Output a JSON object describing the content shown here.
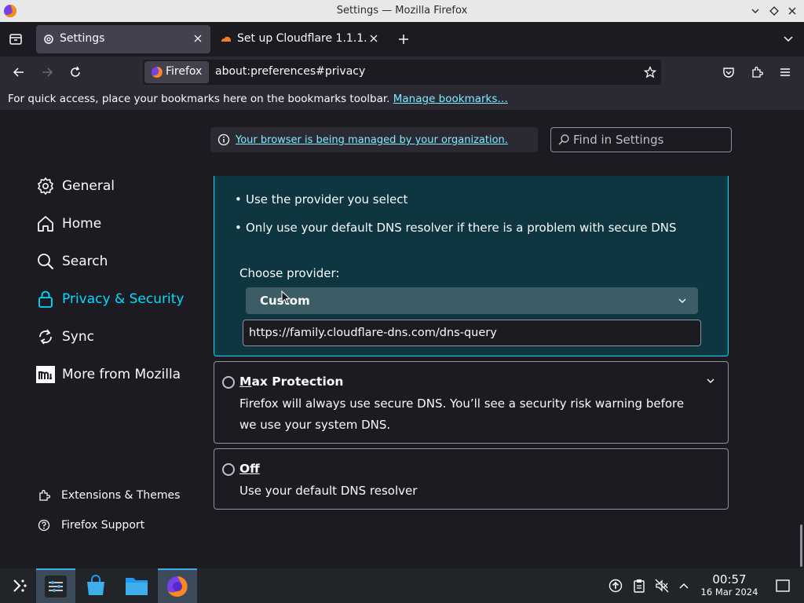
{
  "window": {
    "title": "Settings — Mozilla Firefox",
    "controls": [
      "minimize",
      "maximize",
      "close"
    ]
  },
  "tabs": [
    {
      "label": "Settings",
      "icon": "gear-icon",
      "active": true
    },
    {
      "label": "Set up Cloudflare 1.1.1.1",
      "icon": "cloudflare-icon",
      "active": false
    }
  ],
  "navbar": {
    "identity_label": "Firefox",
    "url": "about:preferences#privacy"
  },
  "bookmarks_bar": {
    "message": "For quick access, place your bookmarks here on the bookmarks toolbar.",
    "link": "Manage bookmarks…"
  },
  "settings": {
    "managed_notice": "Your browser is being managed by your organization.",
    "search_placeholder": "Find in Settings",
    "nav": [
      {
        "label": "General",
        "icon": "gear-icon"
      },
      {
        "label": "Home",
        "icon": "home-icon"
      },
      {
        "label": "Search",
        "icon": "search-icon"
      },
      {
        "label": "Privacy & Security",
        "icon": "lock-icon",
        "selected": true
      },
      {
        "label": "Sync",
        "icon": "sync-icon"
      },
      {
        "label": "More from Mozilla",
        "icon": "mozilla-icon"
      }
    ],
    "footer": [
      {
        "label": "Extensions & Themes",
        "icon": "puzzle-icon"
      },
      {
        "label": "Firefox Support",
        "icon": "help-icon"
      }
    ]
  },
  "dns": {
    "bullets": [
      "Use the provider you select",
      "Only use your default DNS resolver if there is a problem with secure DNS"
    ],
    "choose_label": "Choose provider:",
    "provider_value": "Custom",
    "custom_url": "https://family.cloudflare-dns.com/dns-query",
    "max_protection": {
      "access_key": "M",
      "title_rest": "ax Protection",
      "description": "Firefox will always use secure DNS. You’ll see a security risk warning before we use your system DNS."
    },
    "off": {
      "title": "Off",
      "description": "Use your default DNS resolver"
    }
  },
  "taskbar": {
    "clock_time": "00:57",
    "clock_date": "16 Mar 2024"
  },
  "colors": {
    "accent": "#00ddff",
    "dns_box_bg": "#0d3640",
    "link": "#80ebff"
  }
}
